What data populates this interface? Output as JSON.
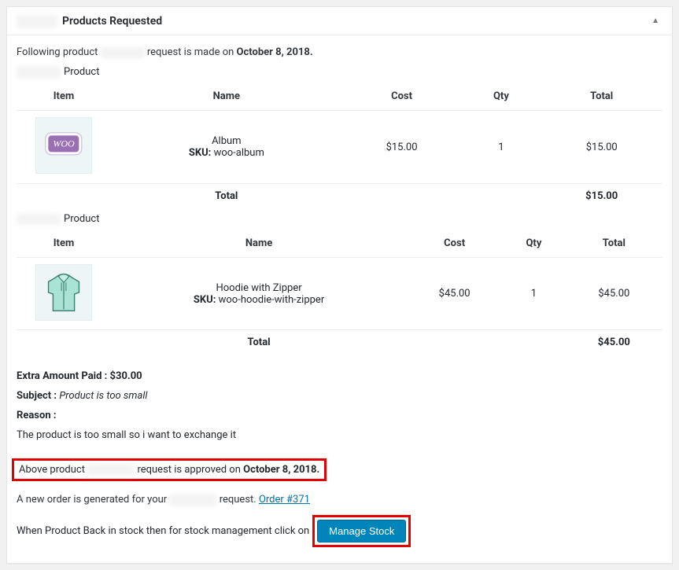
{
  "header": {
    "title": "Products Requested"
  },
  "intro": {
    "prefix": "Following product",
    "mid": "request is made on ",
    "date": "October 8, 2018."
  },
  "product_label": "Product",
  "columns": {
    "item": "Item",
    "name": "Name",
    "cost": "Cost",
    "qty": "Qty",
    "total": "Total"
  },
  "tables": [
    {
      "name": "Album",
      "sku_label": "SKU:",
      "sku": "woo-album",
      "cost": "$15.00",
      "qty": "1",
      "total": "$15.00",
      "grand_label": "Total",
      "grand_total": "$15.00",
      "thumb_kind": "album"
    },
    {
      "name": "Hoodie with Zipper",
      "sku_label": "SKU:",
      "sku": "woo-hoodie-with-zipper",
      "cost": "$45.00",
      "qty": "1",
      "total": "$45.00",
      "grand_label": "Total",
      "grand_total": "$45.00",
      "thumb_kind": "hoodie"
    }
  ],
  "extra": {
    "label": "Extra Amount Paid :",
    "value": "$30.00"
  },
  "subject": {
    "label": "Subject :",
    "value": "Product is too small"
  },
  "reason": {
    "label": "Reason :",
    "body": "The product is too small so i want to exchange it"
  },
  "approved": {
    "prefix": "Above product",
    "mid": "request is approved on ",
    "date": "October 8, 2018."
  },
  "neworder": {
    "prefix": "A new order is generated for your",
    "suffix": "request. ",
    "link": "Order #371"
  },
  "stock": {
    "prefix": "When Product Back in stock then for stock management click on",
    "button": "Manage Stock"
  }
}
